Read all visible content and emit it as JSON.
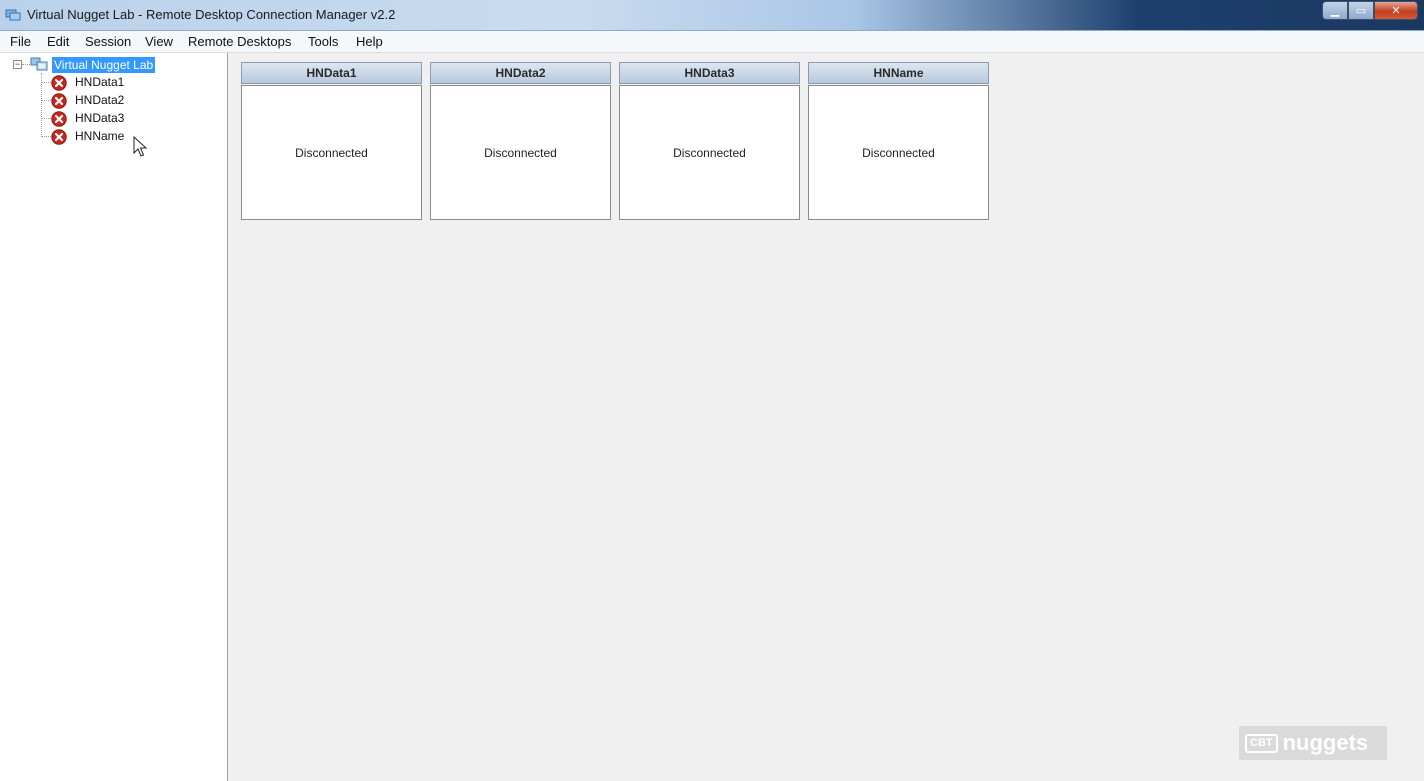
{
  "window": {
    "title": "Virtual Nugget Lab - Remote Desktop Connection Manager v2.2",
    "controls": {
      "minimize": "▁",
      "maximize": "▭",
      "close": "✕"
    }
  },
  "menu": [
    "File",
    "Edit",
    "Session",
    "View",
    "Remote Desktops",
    "Tools",
    "Help"
  ],
  "tree": {
    "root": {
      "label": "Virtual Nugget Lab",
      "expander": "−",
      "selected": true,
      "icon": "server-group-icon"
    },
    "children": [
      {
        "label": "HNData1",
        "status": "disconnected",
        "icon": "error-icon"
      },
      {
        "label": "HNData2",
        "status": "disconnected",
        "icon": "error-icon"
      },
      {
        "label": "HNData3",
        "status": "disconnected",
        "icon": "error-icon"
      },
      {
        "label": "HNName",
        "status": "disconnected",
        "icon": "error-icon"
      }
    ]
  },
  "thumbnails": [
    {
      "title": "HNData1",
      "status": "Disconnected"
    },
    {
      "title": "HNData2",
      "status": "Disconnected"
    },
    {
      "title": "HNData3",
      "status": "Disconnected"
    },
    {
      "title": "HNName",
      "status": "Disconnected"
    }
  ],
  "watermark": {
    "box": "CBT",
    "text": "nuggets"
  },
  "colors": {
    "selection": "#3399ff",
    "error_red": "#c8281c",
    "thumb_header": "#c6d5e6",
    "background": "#f0f0f0"
  }
}
